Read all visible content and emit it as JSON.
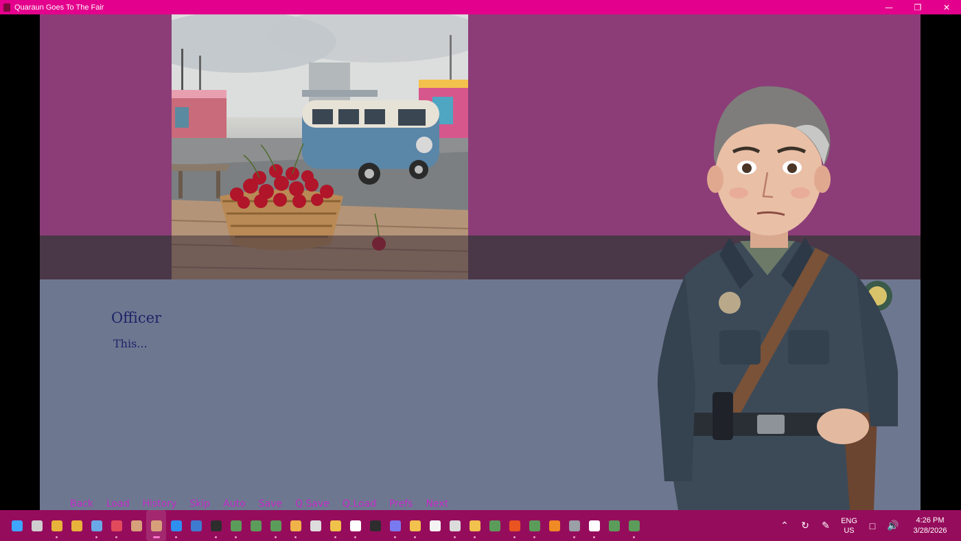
{
  "window": {
    "title": "Quaraun Goes To The Fair",
    "controls": [
      "minimize",
      "restore",
      "close"
    ]
  },
  "dialogue": {
    "speaker": "Officer",
    "text": "This..."
  },
  "quick_menu": {
    "items": [
      "Back",
      "Load",
      "History",
      "Skip",
      "Auto",
      "Save",
      "Q.Save",
      "Q.Load",
      "Prefs",
      "Next"
    ]
  },
  "colors": {
    "titlebar": "#e3008c",
    "top_band": "#8c3d78",
    "dialog_bg": "#6e7790",
    "speaker_text": "#1b2466",
    "quick_menu_text": "#c42ac9",
    "taskbar": "#960c5c"
  },
  "taskbar": {
    "icons": [
      "start-icon",
      "task-view-icon",
      "chrome-icon",
      "chrome-icon",
      "mail-icon",
      "pocket-icon",
      "game-icon",
      "game-icon",
      "vscode-icon",
      "notepad-icon",
      "terminal-icon",
      "app-icon",
      "app-icon",
      "app-icon",
      "pencil-icon",
      "ghost-icon",
      "face-icon",
      "clipboard-icon",
      "terminal-icon",
      "copilot-icon",
      "folder-icon",
      "file-icon",
      "chatgpt-icon",
      "wave-icon",
      "app-icon",
      "ubuntu-icon",
      "app-icon",
      "blender-icon",
      "settings-icon",
      "media-icon",
      "app-icon",
      "app-icon"
    ],
    "language": "ENG",
    "region": "US",
    "time": "4:26 PM",
    "date": "3/28/2026"
  }
}
